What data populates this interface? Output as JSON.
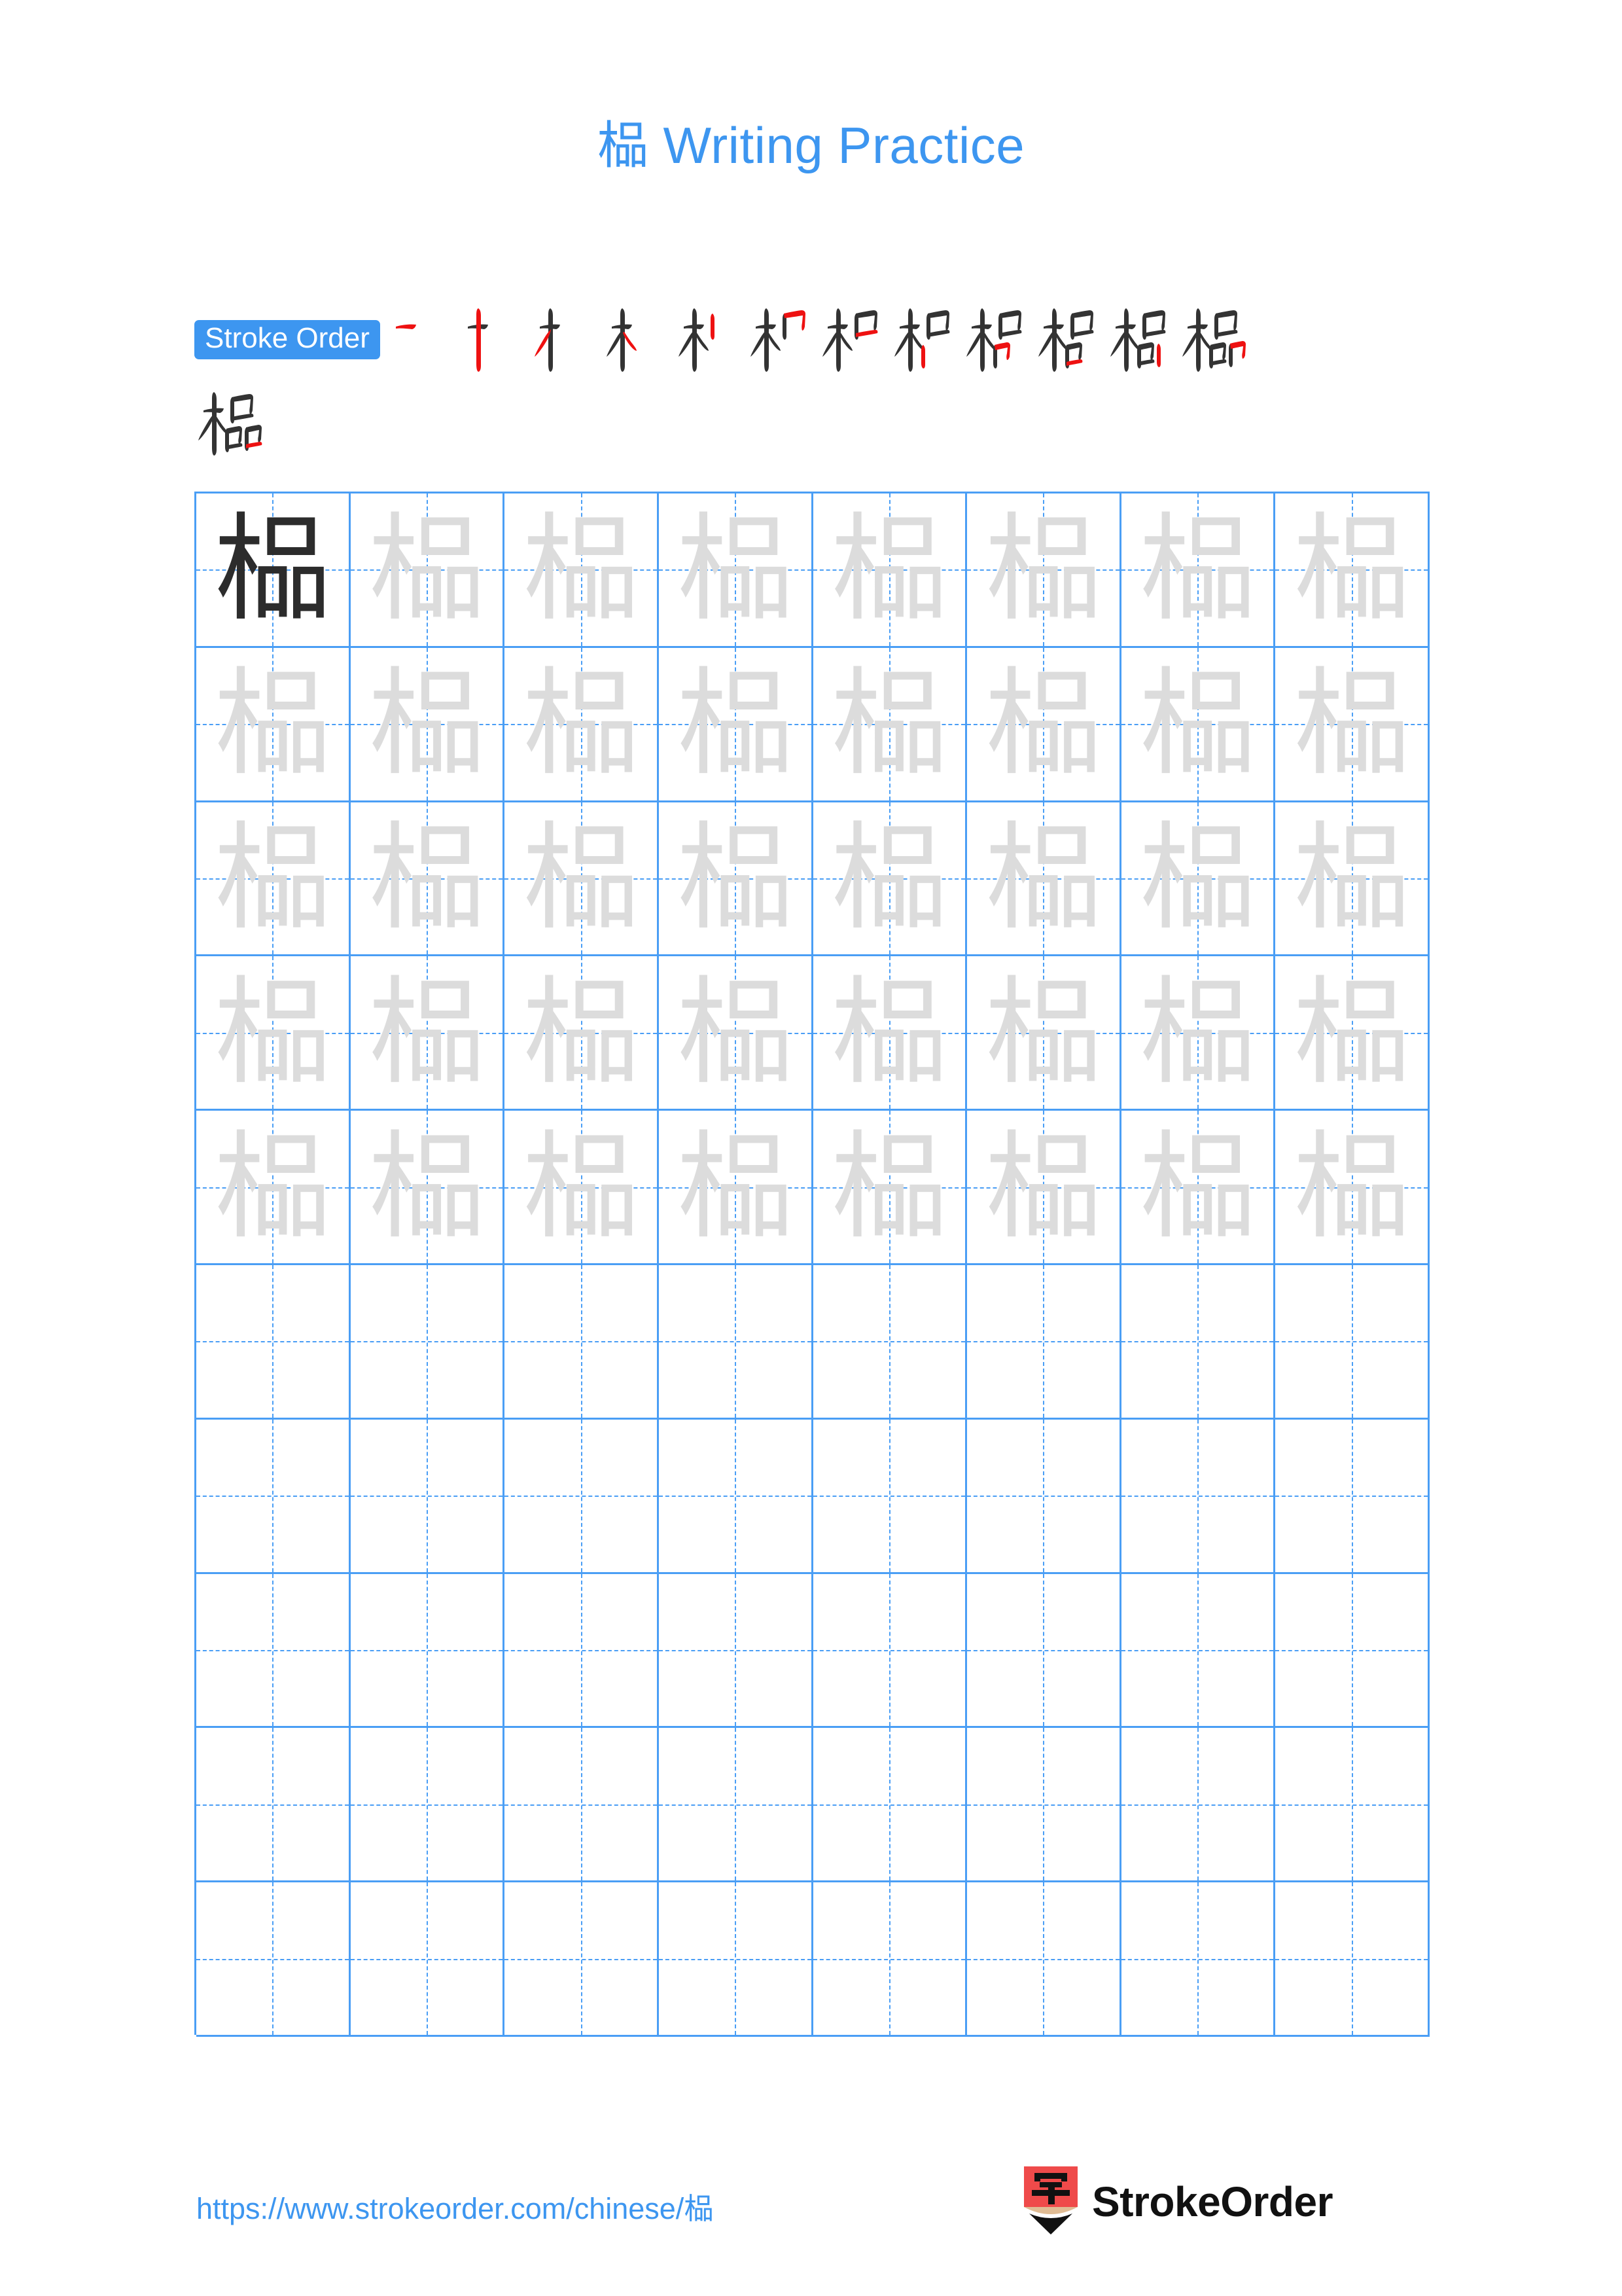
{
  "page": {
    "character": "榀",
    "title_suffix": " Writing Practice",
    "title_full": "榀 Writing Practice",
    "background_color": "#ffffff",
    "accent_color": "#3d96f0",
    "grid_line_color": "#4a9ef5",
    "trace_color": "#dcdcdc",
    "model_char_color": "#2c2c2c",
    "stroke_new_color": "#ee1111",
    "stroke_done_color": "#333333"
  },
  "stroke_order": {
    "badge_label": "Stroke Order",
    "total_strokes": 13,
    "steps": [
      {
        "index": 1,
        "partial": "一"
      },
      {
        "index": 2,
        "partial": "十"
      },
      {
        "index": 3,
        "partial": "オ"
      },
      {
        "index": 4,
        "partial": "木"
      },
      {
        "index": 5,
        "partial": "木丨"
      },
      {
        "index": 6,
        "partial": "朳"
      },
      {
        "index": 7,
        "partial": "朾"
      },
      {
        "index": 8,
        "partial": "机"
      },
      {
        "index": 9,
        "partial": "杞"
      },
      {
        "index": 10,
        "partial": "相"
      },
      {
        "index": 11,
        "partial": "枵"
      },
      {
        "index": 12,
        "partial": "榀"
      },
      {
        "index": 13,
        "partial": "榀"
      }
    ]
  },
  "practice_grid": {
    "columns": 8,
    "rows": 10,
    "model_cell": {
      "row": 1,
      "column": 1,
      "char": "榀",
      "style": "dark"
    },
    "trace_rows": 5,
    "blank_rows": 5,
    "trace_char": "榀"
  },
  "footer": {
    "url": "https://www.strokeorder.com/chinese/榀",
    "brand_name": "StrokeOrder",
    "logo_char": "字",
    "logo_badge_color": "#ef4a4a",
    "logo_wood_color": "#e0bc94",
    "logo_tip_color": "#111111"
  }
}
